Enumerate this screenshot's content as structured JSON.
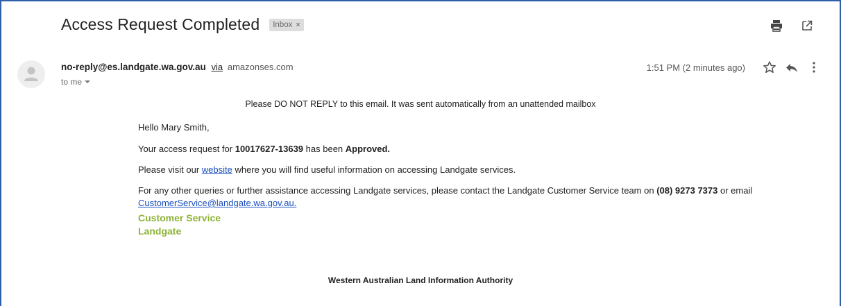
{
  "email": {
    "subject": "Access Request Completed",
    "label": "Inbox",
    "label_remove": "×",
    "sender_email": "no-reply@es.landgate.wa.gov.au",
    "via_text": "via",
    "via_domain": "amazonses.com",
    "recipient": "to me",
    "timestamp": "1:51 PM (2 minutes ago)"
  },
  "message": {
    "notice": "Please DO NOT REPLY to this email. It was sent automatically from an unattended mailbox",
    "greeting": "Hello Mary Smith,",
    "line1_prefix": "Your access request for ",
    "request_id": "10017627-13639",
    "line1_middle": " has been ",
    "status": "Approved.",
    "line2_prefix": "Please visit our ",
    "website_link": "website",
    "line2_suffix": " where you will find useful information on accessing Landgate services.",
    "line3_prefix": "For any other queries or further assistance accessing Landgate services, please contact the Landgate Customer Service team on ",
    "phone": "(08) 9273 7373",
    "line3_middle": " or email ",
    "email_link": "CustomerService@landgate.wa.gov.au.",
    "signature_line1": "Customer Service",
    "signature_line2": "Landgate",
    "footer": "Western Australian Land Information Authority"
  },
  "icons": {
    "print": "print-icon",
    "open_new_window": "open-in-new-window-icon",
    "star": "star-icon",
    "reply": "reply-icon",
    "more": "more-vertical-icon",
    "avatar": "person-avatar-icon"
  },
  "colors": {
    "frame_border": "#2f5fa8",
    "link": "#1a4fbf",
    "signature": "#8fb339",
    "label_chip_bg": "#dddddd"
  }
}
